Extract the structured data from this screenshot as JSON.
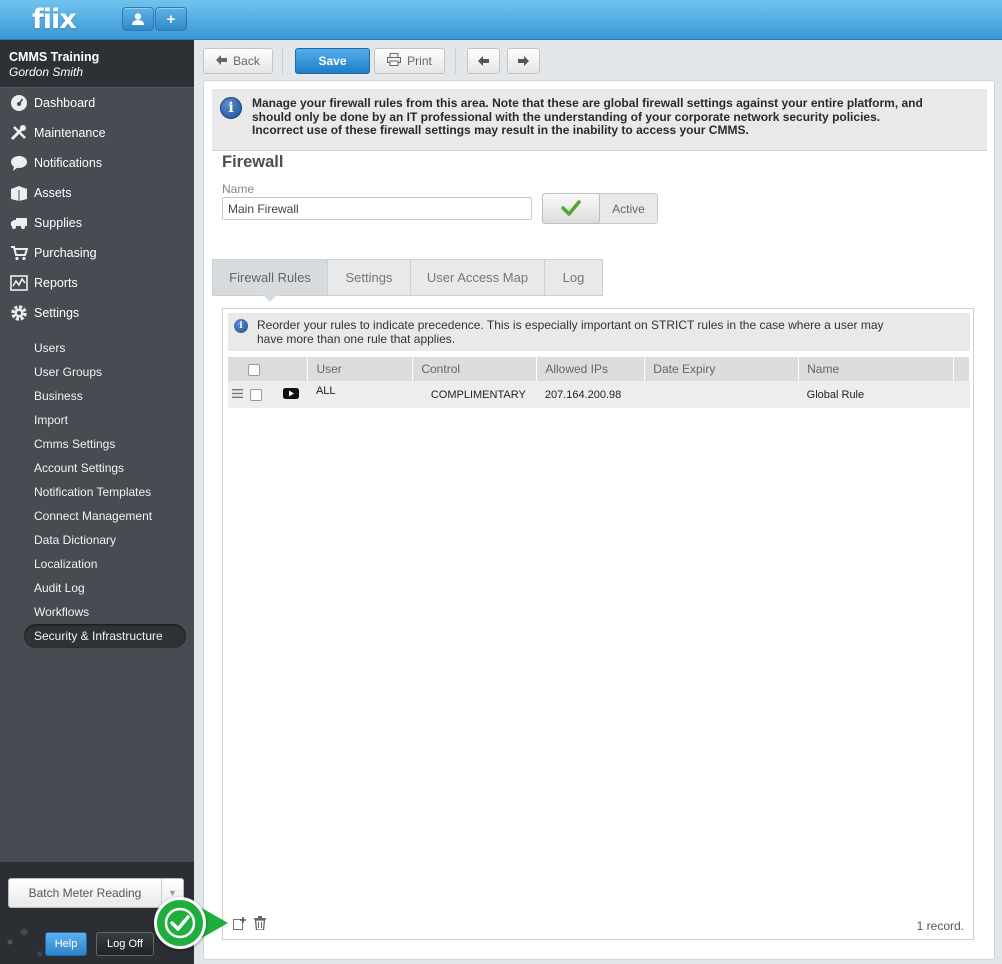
{
  "app": {
    "logo": "fiix"
  },
  "account": {
    "company": "CMMS Training",
    "user": "Gordon Smith"
  },
  "nav": [
    {
      "label": "Dashboard",
      "icon": "dashboard-icon"
    },
    {
      "label": "Maintenance",
      "icon": "tools-icon"
    },
    {
      "label": "Notifications",
      "icon": "chat-bubble-icon"
    },
    {
      "label": "Assets",
      "icon": "box-icon"
    },
    {
      "label": "Supplies",
      "icon": "truck-icon"
    },
    {
      "label": "Purchasing",
      "icon": "cart-icon"
    },
    {
      "label": "Reports",
      "icon": "chart-icon"
    },
    {
      "label": "Settings",
      "icon": "gear-icon"
    }
  ],
  "settings_sub": [
    "Users",
    "User Groups",
    "Business",
    "Import",
    "Cmms Settings",
    "Account Settings",
    "Notification Templates",
    "Connect Management",
    "Data Dictionary",
    "Localization",
    "Audit Log",
    "Workflows",
    "Security & Infrastructure"
  ],
  "footer": {
    "batch": "Batch Meter Reading",
    "help": "Help",
    "logoff": "Log Off"
  },
  "toolbar": {
    "back": "Back",
    "save": "Save",
    "print": "Print"
  },
  "banner": "Manage your firewall rules from this area. Note that these are global firewall settings against your entire platform, and should only be done by an IT professional with the understanding of your corporate network security policies. Incorrect use of these firewall settings may result in the inability to access your CMMS.",
  "form": {
    "title": "Firewall",
    "name_label": "Name",
    "name_value": "Main Firewall",
    "active_label": "Active"
  },
  "tabs": [
    "Firewall Rules",
    "Settings",
    "User Access Map",
    "Log"
  ],
  "grid": {
    "info": "Reorder your rules to indicate precedence. This is especially important on STRICT rules in the case where a user may have more than one rule that applies.",
    "columns": [
      "User",
      "Control",
      "Allowed IPs",
      "Date Expiry",
      "Name"
    ],
    "rows": [
      {
        "user": "ALL",
        "control": "COMPLIMENTARY",
        "ips": "207.164.200.98",
        "expiry": "",
        "name": "Global Rule"
      }
    ],
    "record_count": "1 record."
  }
}
